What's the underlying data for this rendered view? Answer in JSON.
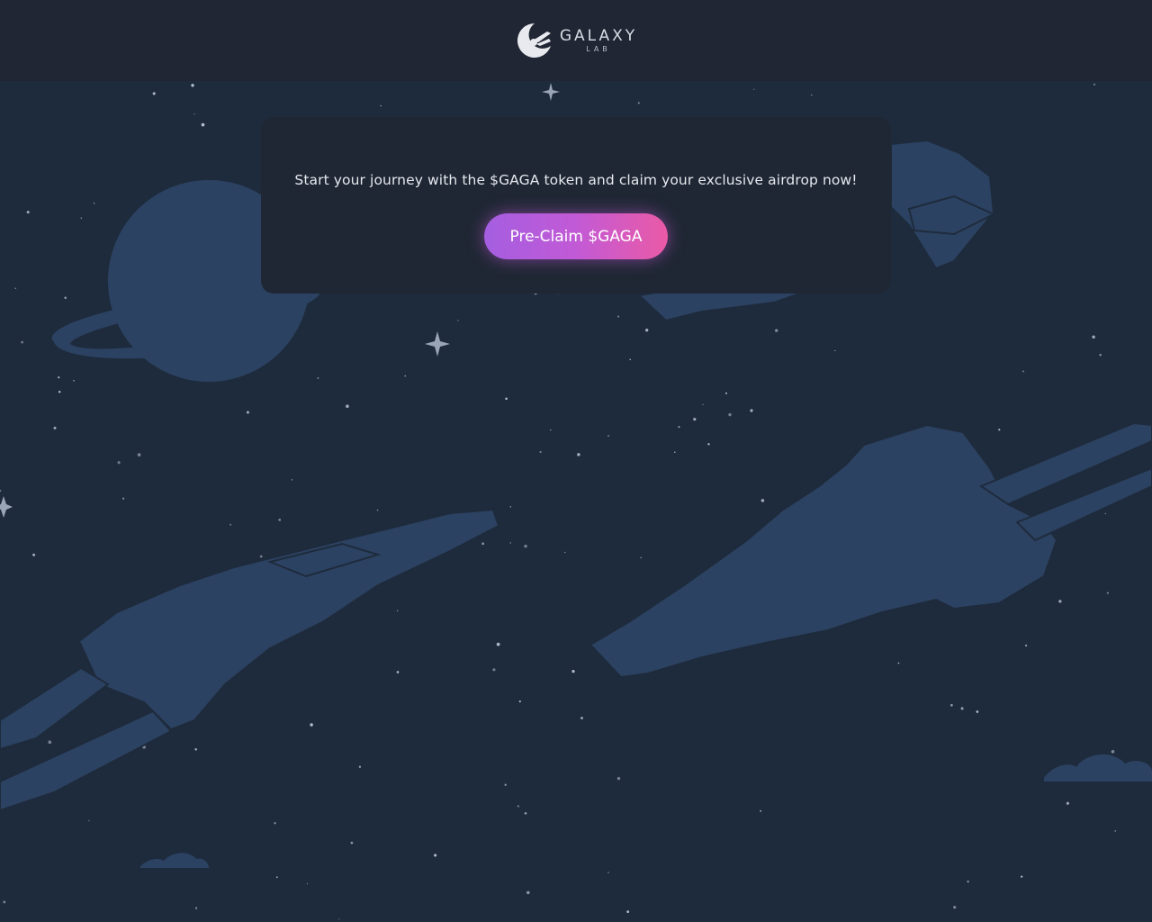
{
  "header": {
    "logo_word": "GALAXY",
    "logo_sub": "LAB",
    "logo_icon": "galaxy-lab-moon-icon"
  },
  "card": {
    "message": "Start your journey with the $GAGA token and claim your exclusive airdrop now!",
    "button_label": "Pre-Claim $GAGA"
  },
  "colors": {
    "background": "#1e2b3c",
    "header": "#202634",
    "card": "#1f2734",
    "illustration": "#2c4262",
    "button_gradient_start": "#a45ee0",
    "button_gradient_end": "#ea5aa6"
  }
}
